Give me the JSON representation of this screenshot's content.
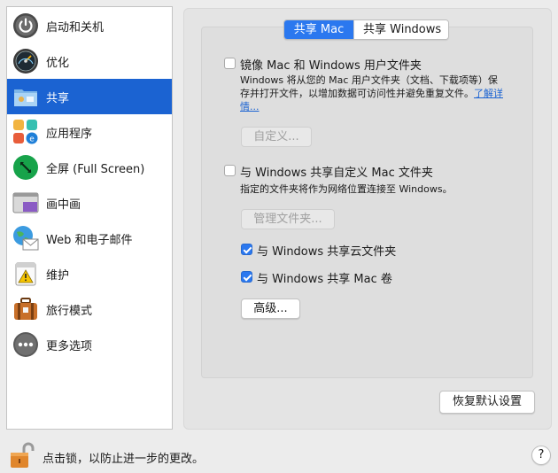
{
  "sidebar": {
    "items": [
      {
        "label": "启动和关机",
        "icon": "power-icon"
      },
      {
        "label": "优化",
        "icon": "gauge-icon"
      },
      {
        "label": "共享",
        "icon": "shared-folder-icon"
      },
      {
        "label": "应用程序",
        "icon": "applications-icon"
      },
      {
        "label": "全屏 (Full Screen)",
        "icon": "fullscreen-icon"
      },
      {
        "label": "画中画",
        "icon": "picture-in-picture-icon"
      },
      {
        "label": "Web 和电子邮件",
        "icon": "web-mail-icon"
      },
      {
        "label": "维护",
        "icon": "maintenance-icon"
      },
      {
        "label": "旅行模式",
        "icon": "travel-suitcase-icon"
      },
      {
        "label": "更多选项",
        "icon": "more-options-icon"
      }
    ],
    "selected_index": 2
  },
  "tabs": {
    "mac": "共享 Mac",
    "windows": "共享 Windows",
    "active": "mac"
  },
  "options": {
    "mirror": {
      "label": "镜像 Mac 和 Windows 用户文件夹",
      "checked": false,
      "desc_part1": "Windows 将从您的 Mac 用户文件夹（文档、下载项等）保存并打开文件，以增加数据可访问性并避免重复文件。",
      "link": "了解详情...",
      "button": "自定义..."
    },
    "share_custom": {
      "label": "与 Windows 共享自定义 Mac 文件夹",
      "checked": false,
      "desc": "指定的文件夹将作为网络位置连接至 Windows。",
      "button": "管理文件夹..."
    },
    "share_cloud": {
      "label": "与 Windows 共享云文件夹",
      "checked": true
    },
    "share_volumes": {
      "label": "与 Windows 共享 Mac 卷",
      "checked": true
    },
    "advanced_button": "高级..."
  },
  "footer": {
    "restore_button": "恢复默认设置",
    "lock_text": "点击锁，以防止进一步的更改。",
    "help": "?"
  },
  "colors": {
    "accent": "#1b63d2",
    "segment_active": "#2b78ef"
  }
}
